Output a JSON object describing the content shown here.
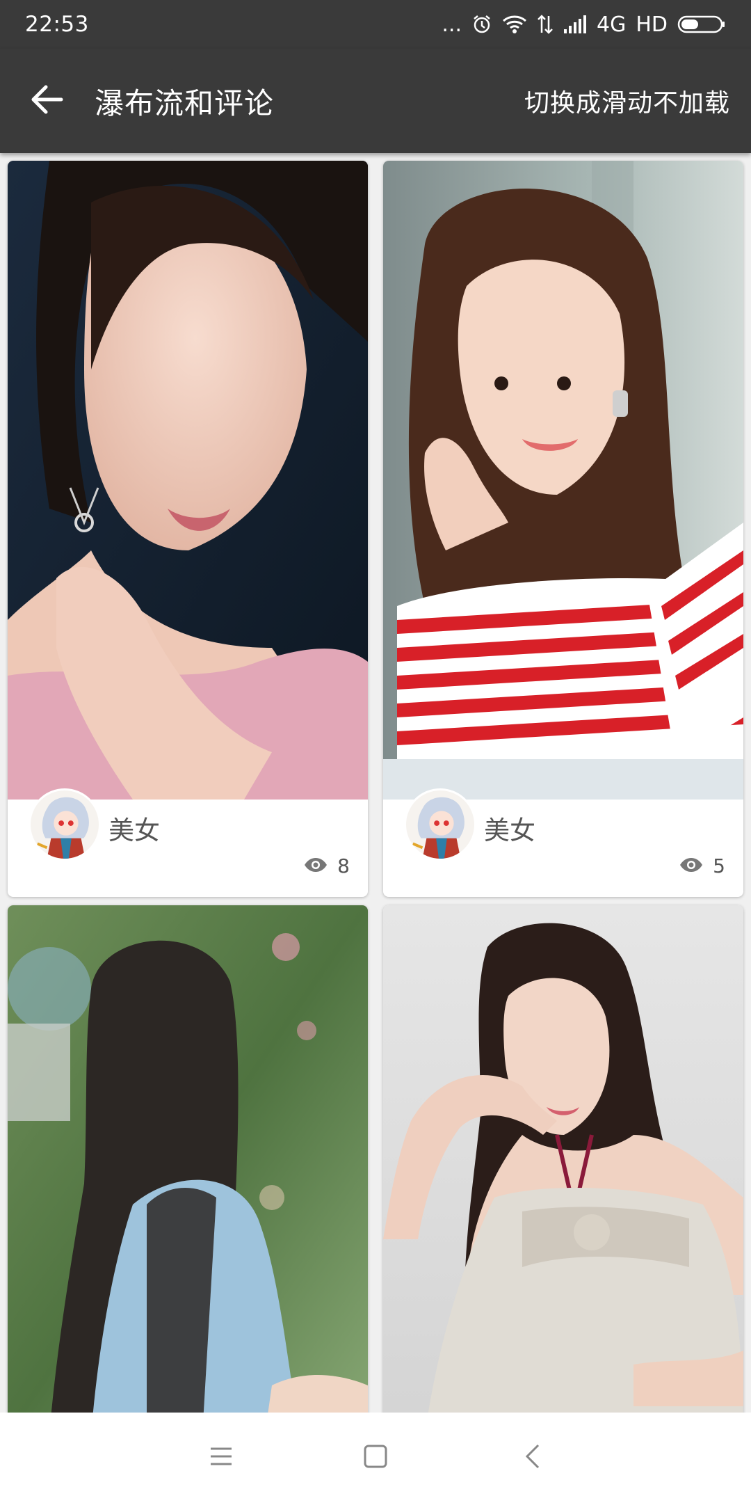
{
  "status_bar": {
    "time": "22:53",
    "dots": "...",
    "network": "4G",
    "hd": "HD"
  },
  "toolbar": {
    "title": "瀑布流和评论",
    "action": "切换成滑动不加载",
    "background": "#3a3a3a"
  },
  "cards": [
    {
      "name": "美女",
      "views": "8"
    },
    {
      "name": "美女",
      "views": "5"
    }
  ],
  "icons": {
    "back": "back-arrow-icon",
    "views": "eye-icon",
    "nav_menu": "menu-icon",
    "nav_home": "home-square-icon",
    "nav_back": "back-chevron-icon"
  }
}
